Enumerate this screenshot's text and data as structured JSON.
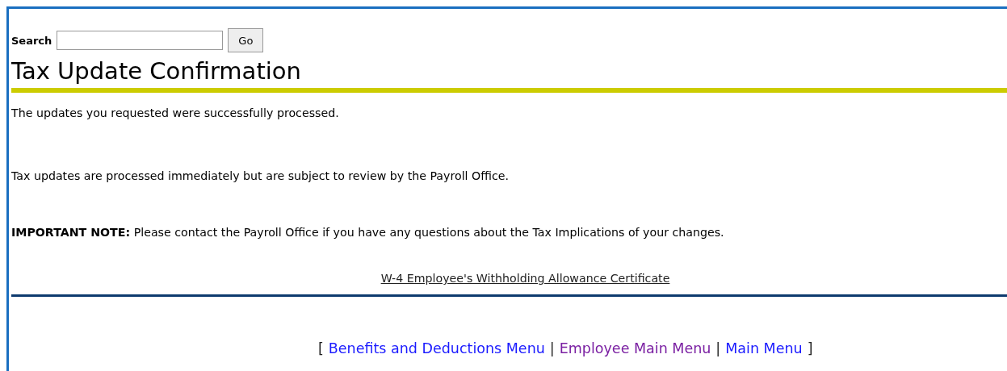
{
  "search": {
    "label": "Search",
    "button": "Go"
  },
  "title": "Tax Update Confirmation",
  "messages": [
    "The updates you requested were successfully processed.",
    "Tax updates are processed immediately but are subject to review by the Payroll Office.",
    "**IMPORTANT NOTE:** Please contact the Payroll Office if you have any questions about the Tax Implications of your changes."
  ],
  "certificate_link": "W-4 Employee's Withholding Allowance Certificate",
  "nav": [
    {
      "kind": "bracket",
      "text": "["
    },
    {
      "kind": "link",
      "text": "Benefits and Deductions Menu",
      "visited": false
    },
    {
      "kind": "separator",
      "text": "|"
    },
    {
      "kind": "link",
      "text": "Employee Main Menu",
      "visited": true
    },
    {
      "kind": "separator",
      "text": "|"
    },
    {
      "kind": "link",
      "text": "Main Menu",
      "visited": false
    },
    {
      "kind": "bracket",
      "text": "]"
    }
  ]
}
